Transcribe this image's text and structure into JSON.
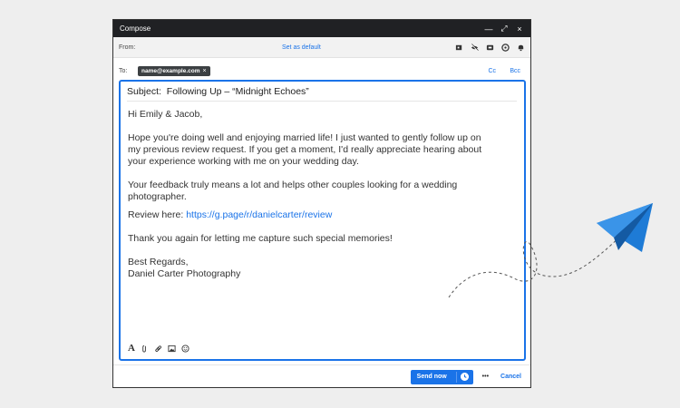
{
  "window": {
    "title": "Compose",
    "minimize_glyph": "—",
    "expand_glyph": "⤢",
    "close_glyph": "×"
  },
  "from": {
    "label": "From:",
    "set_default": "Set as default",
    "icons": [
      "tag-icon",
      "hide-icon",
      "archive-icon",
      "dashboard-icon",
      "bell-icon"
    ]
  },
  "to": {
    "label": "To:",
    "recipient": "name@example.com",
    "chip_close": "×",
    "cc": "Cc",
    "bcc": "Bcc"
  },
  "message": {
    "subject_label": "Subject:",
    "subject": "Following Up – “Midnight Echoes”",
    "greeting": "Hi Emily & Jacob,",
    "para1_line1": "Hope you're doing well and enjoying married life! I just wanted to gently follow up on",
    "para1_line2": "my previous review request. If you get a moment, I'd really appreciate hearing about",
    "para1_line3": "your experience working with me on your wedding day.",
    "para2_line1": "Your feedback truly means a lot and helps other couples looking for a wedding",
    "para2_line2": "photographer.",
    "review_label": "Review here:",
    "review_link": "https://g.page/r/danielcarter/review",
    "thanks": "Thank you again for letting me capture such special memories!",
    "signoff": "Best Regards,",
    "signature": "Daniel Carter Photography"
  },
  "toolbar": {
    "format_glyph": "A",
    "icons": [
      "text-format-icon",
      "attach-icon",
      "link-icon",
      "image-icon",
      "emoji-icon"
    ]
  },
  "footer": {
    "send_label": "Send now",
    "more": "•••",
    "cancel": "Cancel"
  },
  "colors": {
    "accent": "#1a73e8",
    "titlebar": "#202124",
    "plane": "#1e7bd6"
  }
}
